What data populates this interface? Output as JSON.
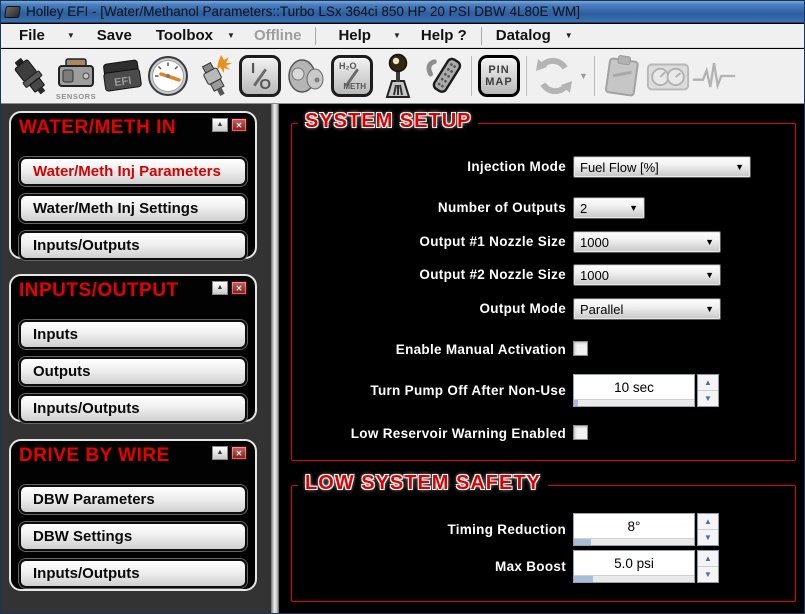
{
  "window": {
    "title": "Holley EFI - [Water/Methanol Parameters::Turbo LSx 364ci 850 HP 20 PSI DBW 4L80E WM]"
  },
  "menu": {
    "items": [
      {
        "label": "File",
        "has_arrow": true,
        "enabled": true
      },
      {
        "label": "Save",
        "has_arrow": false,
        "enabled": true
      },
      {
        "label": "Toolbox",
        "has_arrow": true,
        "enabled": true
      },
      {
        "label": "Offline",
        "has_arrow": false,
        "enabled": false
      },
      {
        "label": "Help",
        "has_arrow": true,
        "enabled": true
      },
      {
        "label": "Help ?",
        "has_arrow": false,
        "enabled": true
      },
      {
        "label": "Datalog",
        "has_arrow": true,
        "enabled": true
      }
    ]
  },
  "toolbar": {
    "icons": [
      {
        "name": "fuel-injector",
        "disabled": false
      },
      {
        "name": "sensors",
        "label": "SENSORS",
        "disabled": false
      },
      {
        "name": "efi-ecu",
        "label": "EFI",
        "disabled": false
      },
      {
        "name": "gauge",
        "disabled": false
      },
      {
        "name": "spark-plug",
        "disabled": false
      },
      {
        "name": "io-setup",
        "label_top": "I",
        "label_bottom": "O",
        "disabled": false
      },
      {
        "name": "water-pump",
        "disabled": false
      },
      {
        "name": "h2o-meth",
        "label_top": "H₂O",
        "label_bottom": "METH",
        "disabled": false
      },
      {
        "name": "shifter",
        "disabled": false
      },
      {
        "name": "wiring-harness",
        "disabled": false
      },
      {
        "name": "pin-map",
        "label_top": "PIN",
        "label_bottom": "MAP",
        "disabled": false
      },
      {
        "name": "sync",
        "disabled": true
      },
      {
        "name": "datalog-clipboard",
        "disabled": true
      },
      {
        "name": "dash-gauges",
        "disabled": true
      },
      {
        "name": "monitor-pulse",
        "disabled": true
      }
    ]
  },
  "sidebar": {
    "panels": [
      {
        "title": "WATER/METH IN",
        "buttons": [
          {
            "label": "Water/Meth Inj Parameters",
            "active": true
          },
          {
            "label": "Water/Meth Inj Settings",
            "active": false
          },
          {
            "label": "Inputs/Outputs",
            "active": false
          }
        ]
      },
      {
        "title": "INPUTS/OUTPUT",
        "buttons": [
          {
            "label": "Inputs",
            "active": false
          },
          {
            "label": "Outputs",
            "active": false
          },
          {
            "label": "Inputs/Outputs",
            "active": false
          }
        ]
      },
      {
        "title": "DRIVE BY WIRE",
        "buttons": [
          {
            "label": "DBW Parameters",
            "active": false
          },
          {
            "label": "DBW Settings",
            "active": false
          },
          {
            "label": "Inputs/Outputs",
            "active": false
          }
        ]
      }
    ]
  },
  "main": {
    "system_setup": {
      "title": "SYSTEM SETUP",
      "injection_mode": {
        "label": "Injection Mode",
        "value": "Fuel Flow [%]"
      },
      "number_of_outputs": {
        "label": "Number of Outputs",
        "value": "2"
      },
      "output1_nozzle": {
        "label": "Output #1 Nozzle Size",
        "value": "1000"
      },
      "output2_nozzle": {
        "label": "Output #2 Nozzle Size",
        "value": "1000"
      },
      "output_mode": {
        "label": "Output Mode",
        "value": "Parallel"
      },
      "enable_manual_activation": {
        "label": "Enable Manual Activation",
        "checked": false
      },
      "pump_off_after_nonuse": {
        "label": "Turn Pump Off After Non-Use",
        "value": "10 sec"
      },
      "low_reservoir_warning": {
        "label": "Low Reservoir Warning Enabled",
        "checked": false
      }
    },
    "low_system_safety": {
      "title": "LOW SYSTEM SAFETY",
      "timing_reduction": {
        "label": "Timing Reduction",
        "value": "8°"
      },
      "max_boost": {
        "label": "Max Boost",
        "value": "5.0 psi"
      }
    }
  },
  "colors": {
    "accent_red": "#e40000",
    "titlebar_blue": "#3a6fb0",
    "sidebar_gray": "#333333",
    "spinner_arrow_blue": "#4a6ab8"
  }
}
